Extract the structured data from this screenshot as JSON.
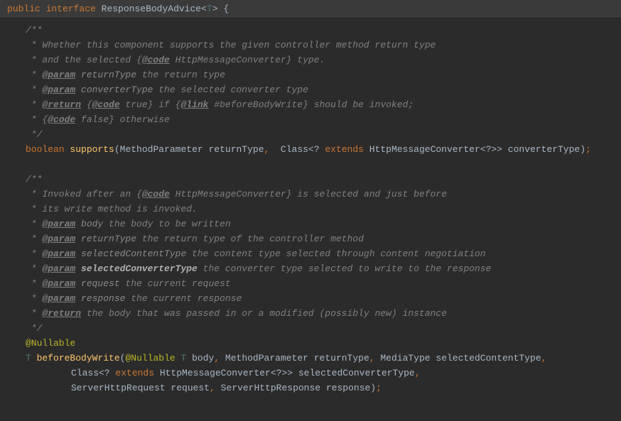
{
  "header": {
    "public": "public",
    "interface": "interface",
    "name": "ResponseBodyAdvice",
    "lt": "<",
    "tparam": "T",
    "gt": ">",
    "brace": " {"
  },
  "c1": {
    "l1": "/**",
    "l2": " * Whether this component supports the given controller method return type",
    "l3": " * and the selected {",
    "l3tag": "@code",
    "l3b": " HttpMessageConverter} type.",
    "l4": " * ",
    "l4tag": "@param",
    "l4n": " returnType",
    "l4d": " the return type",
    "l5": " * ",
    "l5tag": "@param",
    "l5n": " converterType",
    "l5d": " the selected converter type",
    "l6": " * ",
    "l6tag": "@return",
    "l6a": " {",
    "l6code": "@code",
    "l6b": " true} if {",
    "l6link": "@link",
    "l6c": " #beforeBodyWrite} should be invoked;",
    "l7": " * {",
    "l7code": "@code",
    "l7b": " false} otherwise",
    "l8": " */"
  },
  "m1": {
    "ret": "boolean",
    "name": "supports",
    "p1t": "MethodParameter",
    "p1n": " returnType",
    "c1": ", ",
    "p2a": " Class<? ",
    "ext": "extends",
    "p2b": " HttpMessageConverter<?>> converterType)",
    "semi": ";",
    "lparen": "("
  },
  "c2": {
    "l1": "/**",
    "l2a": " * Invoked after an {",
    "l2tag": "@code",
    "l2b": " HttpMessageConverter} is selected and just before",
    "l3": " * its write method is invoked.",
    "l4": " * ",
    "l4tag": "@param",
    "l4n": " body",
    "l4d": " the body to be written",
    "l5": " * ",
    "l5tag": "@param",
    "l5n": " returnType",
    "l5d": " the return type of the controller method",
    "l6": " * ",
    "l6tag": "@param",
    "l6n": " selectedContentType",
    "l6d": " the content type selected through content negotiation",
    "l7": " * ",
    "l7tag": "@param",
    "l7n": " selectedConverterType",
    "l7d": " the converter type selected to write to the response",
    "l8": " * ",
    "l8tag": "@param",
    "l8n": " request",
    "l8d": " the current request",
    "l9": " * ",
    "l9tag": "@param",
    "l9n": " response",
    "l9d": " the current response",
    "l10": " * ",
    "l10tag": "@return",
    "l10d": " the body that was passed in or a modified (possibly new) instance",
    "l11": " */"
  },
  "ann": "@Nullable",
  "m2": {
    "ret": "T",
    "name": "beforeBodyWrite",
    "p1ann": "@Nullable",
    "p1t": " T",
    "p1n": " body",
    "c1": ",",
    "p2": " MethodParameter returnType",
    "c2": ",",
    "p3": " MediaType selectedContentType",
    "c3": ",",
    "l2a": "Class<? ",
    "ext": "extends",
    "l2b": " HttpMessageConverter<?>> selectedConverterType",
    "c4": ",",
    "l3a": "ServerHttpRequest request",
    "c5": ",",
    "l3b": " ServerHttpResponse response)",
    "semi": ";",
    "lparen": "("
  }
}
